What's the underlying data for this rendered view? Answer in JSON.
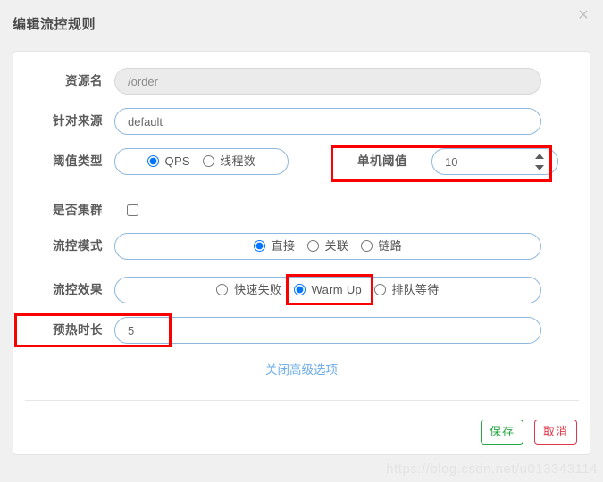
{
  "dialog": {
    "title": "编辑流控规则",
    "close_icon": "close-icon",
    "close_glyph": "✕"
  },
  "form": {
    "resource": {
      "label": "资源名",
      "value": "/order",
      "disabled": true
    },
    "origin": {
      "label": "针对来源",
      "value": "default"
    },
    "threshold_type": {
      "label": "阈值类型",
      "options": [
        {
          "label": "QPS",
          "selected": true
        },
        {
          "label": "线程数",
          "selected": false
        }
      ]
    },
    "single_threshold": {
      "label": "单机阈值",
      "value": "10",
      "spinner_icon": "number-spinner-icon"
    },
    "is_cluster": {
      "label": "是否集群",
      "checked": false
    },
    "flow_mode": {
      "label": "流控模式",
      "options": [
        {
          "label": "直接",
          "selected": true
        },
        {
          "label": "关联",
          "selected": false
        },
        {
          "label": "链路",
          "selected": false
        }
      ]
    },
    "flow_effect": {
      "label": "流控效果",
      "options": [
        {
          "label": "快速失败",
          "selected": false
        },
        {
          "label": "Warm Up",
          "selected": true
        },
        {
          "label": "排队等待",
          "selected": false
        }
      ]
    },
    "warmup_period": {
      "label": "预热时长",
      "value": "5"
    }
  },
  "advanced_link": {
    "label": "关闭高级选项"
  },
  "footer": {
    "save_label": "保存",
    "cancel_label": "取消"
  },
  "annotations": {
    "accent_color": "#fa0000",
    "items": [
      {
        "name": "single-threshold"
      },
      {
        "name": "warm-up-option"
      },
      {
        "name": "warmup-period"
      }
    ]
  },
  "watermark": {
    "text": "https://blog.csdn.net/u013343114"
  }
}
